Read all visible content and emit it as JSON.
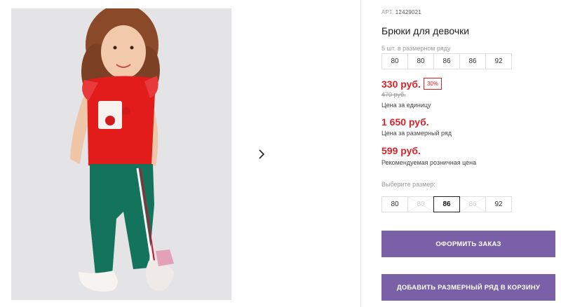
{
  "product": {
    "article_label": "АРТ.",
    "article_number": "12429021",
    "title": "Брюки для девочки",
    "pack_note": "5 шт. в размерном ряду",
    "pack_sizes": [
      "80",
      "80",
      "86",
      "86",
      "92"
    ],
    "price_unit": "330 руб.",
    "discount": "30%",
    "old_price": "470 руб.",
    "price_unit_caption": "Цена за единицу",
    "price_pack": "1 650 руб.",
    "price_pack_caption": "Цена за размерный ряд",
    "price_retail": "599 руб.",
    "price_retail_caption": "Рекомендуемая розничная цена",
    "choose_size_label": "Выберите размер:",
    "size_options": [
      {
        "label": "80",
        "state": "available"
      },
      {
        "label": "80",
        "state": "disabled"
      },
      {
        "label": "86",
        "state": "selected"
      },
      {
        "label": "86",
        "state": "disabled"
      },
      {
        "label": "92",
        "state": "available"
      }
    ]
  },
  "buttons": {
    "order": "ОФОРМИТЬ ЗАКАЗ",
    "add_pack": "ДОБАВИТЬ РАЗМЕРНЫЙ РЯД В КОРЗИНУ"
  },
  "gallery": {
    "next_icon": "chevron-right-icon"
  },
  "colors": {
    "accent": "#7a60a6",
    "price_red": "#d8232a"
  }
}
